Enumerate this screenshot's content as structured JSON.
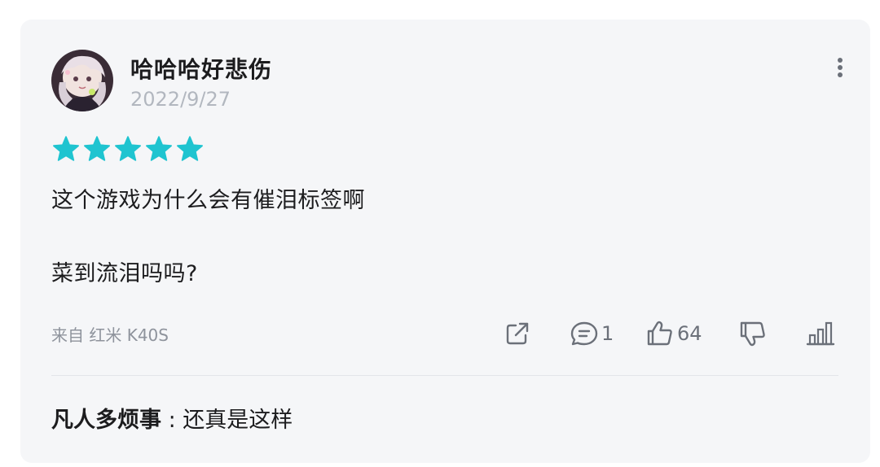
{
  "review": {
    "username": "哈哈哈好悲伤",
    "date": "2022/9/27",
    "rating": 5,
    "star_color": "#1fc4d0",
    "text_line1": "这个游戏为什么会有催泪标签啊",
    "text_line2": "菜到流泪吗吗?",
    "device": "来自 红米 K40S"
  },
  "actions": {
    "comments": "1",
    "likes": "64"
  },
  "reply": {
    "author": "凡人多烦事",
    "separator": " : ",
    "text": "还真是这样"
  },
  "icons": {
    "more": "more-vertical-icon",
    "share": "share-icon",
    "comment": "comment-icon",
    "like": "thumbs-up-icon",
    "dislike": "thumbs-down-icon",
    "stats": "bar-chart-icon"
  }
}
